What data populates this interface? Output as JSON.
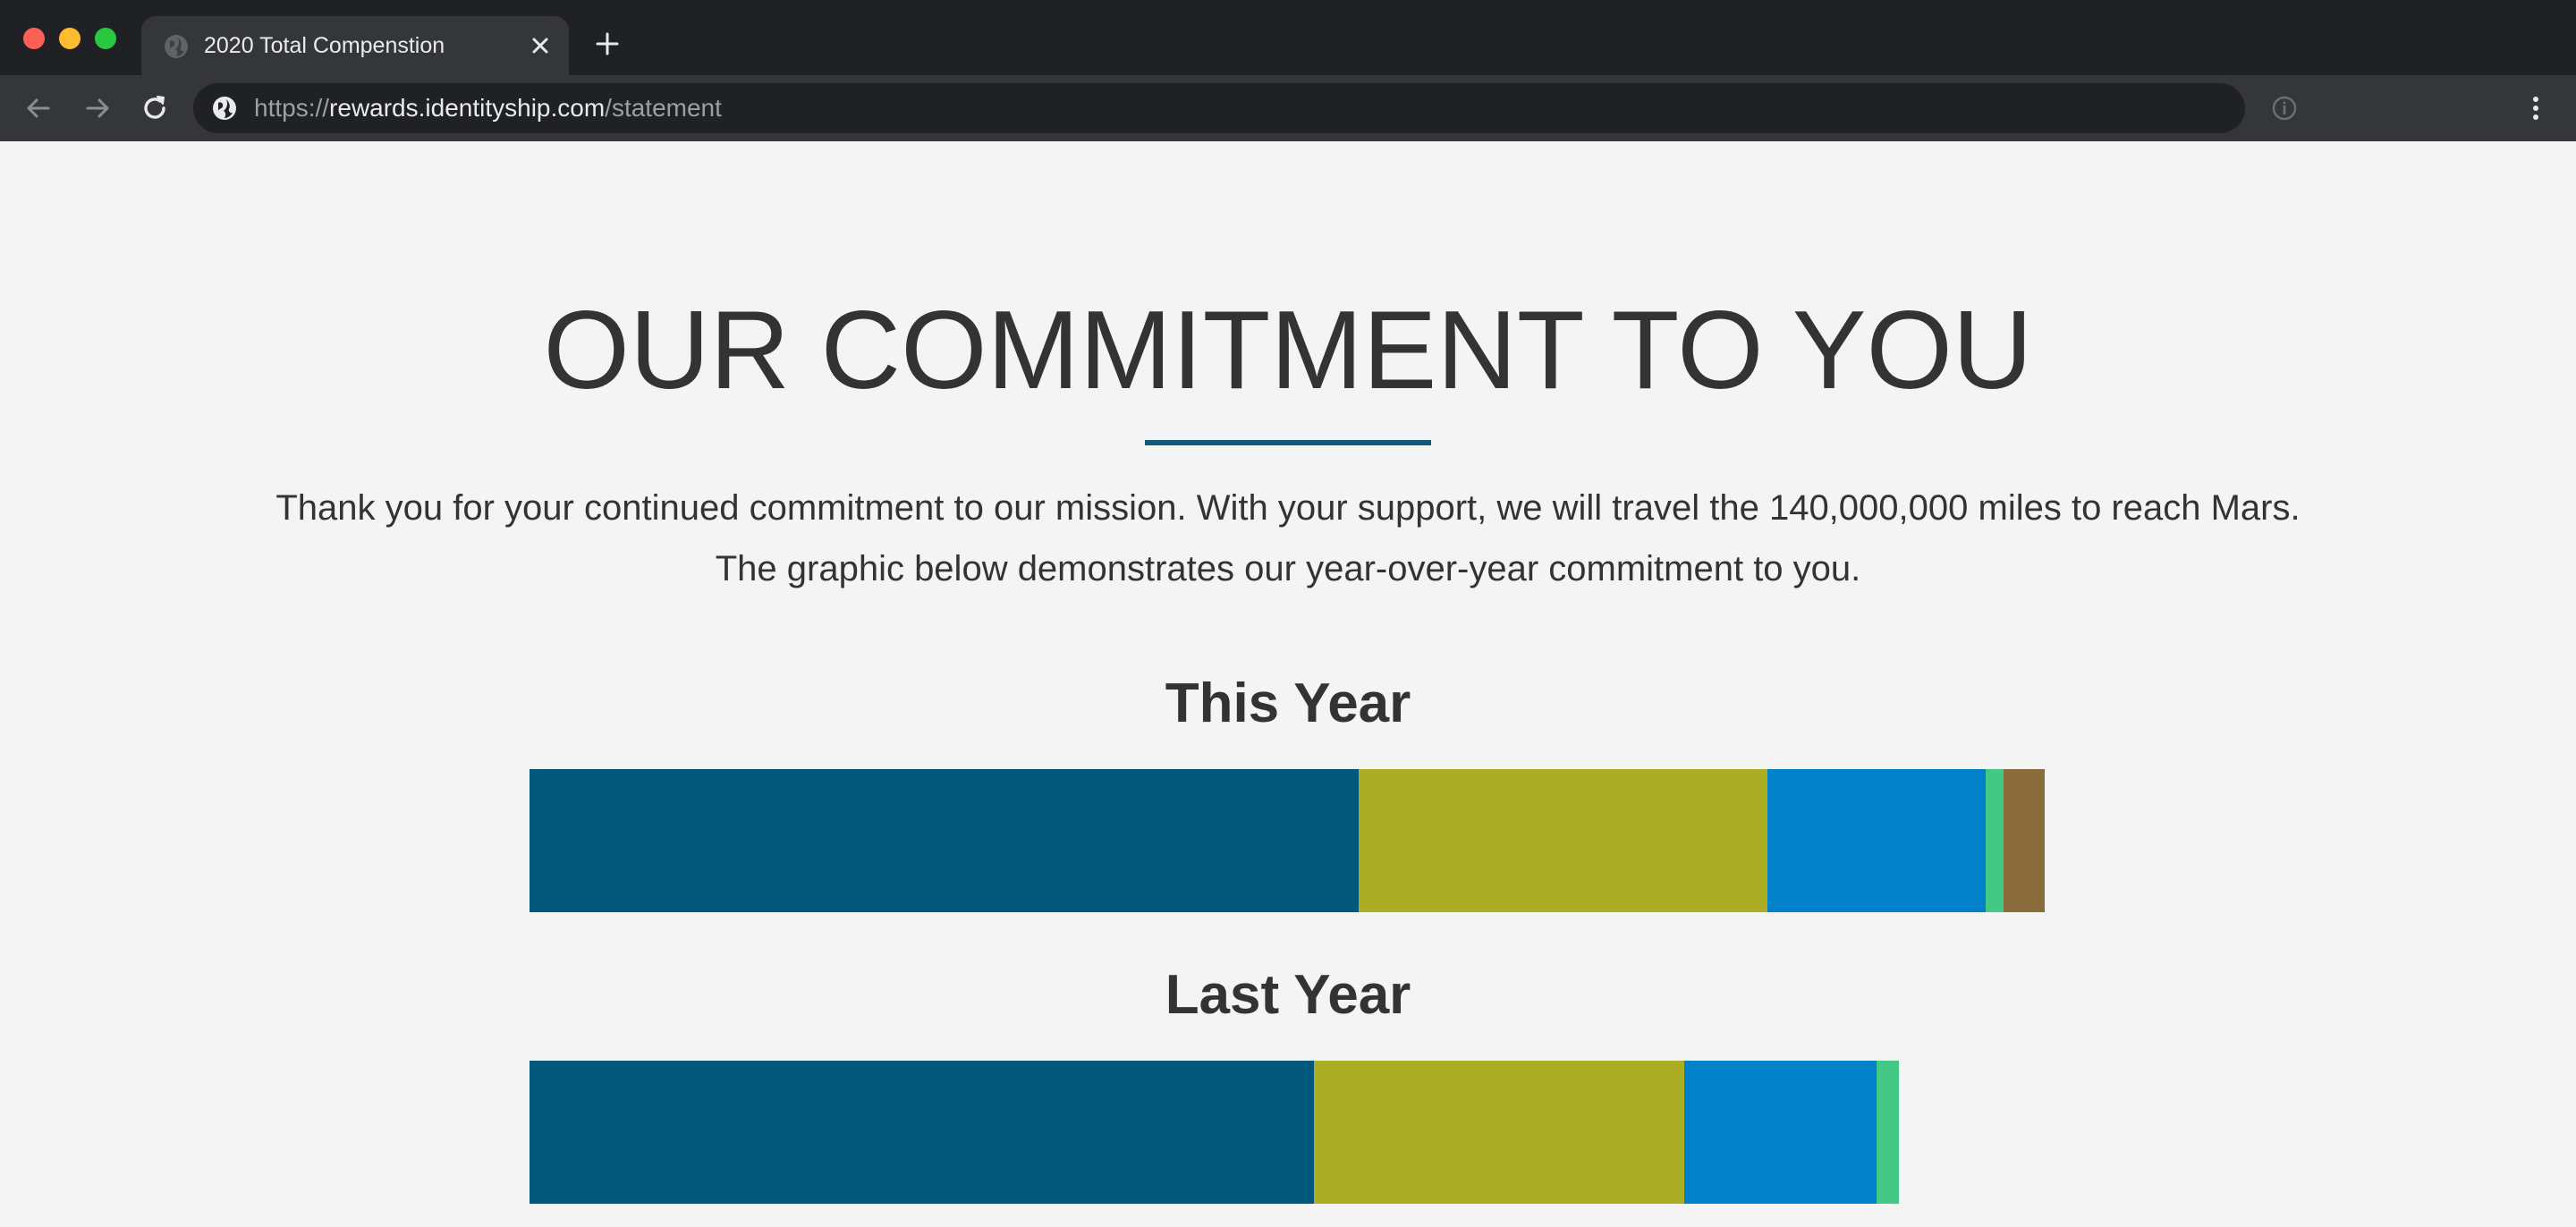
{
  "browser": {
    "tab_title": "2020 Total Compenstion",
    "url_scheme": "https://",
    "url_host": "rewards.identityship.com",
    "url_path": "/statement"
  },
  "page": {
    "headline": "OUR COMMITMENT TO YOU",
    "intro": "Thank you for your continued commitment to our mission. With your support, we will travel the 140,000,000 miles to reach Mars. The graphic below demonstrates our year-over-year commitment to you."
  },
  "colors": {
    "segment_1": "#02587a",
    "segment_2": "#abad25",
    "segment_3": "#0081c9",
    "segment_4": "#44c885",
    "segment_5": "#8b6c3d",
    "divider": "#0c5b7a"
  },
  "chart_data": {
    "type": "bar",
    "orientation": "horizontal-stacked",
    "categories": [
      "This Year",
      "Last Year"
    ],
    "scale_max": 100,
    "series": [
      {
        "color": "#02587a",
        "values": [
          54.7,
          51.8
        ]
      },
      {
        "color": "#abad25",
        "values": [
          27.0,
          24.4
        ]
      },
      {
        "color": "#0081c9",
        "values": [
          14.4,
          12.7
        ]
      },
      {
        "color": "#44c885",
        "values": [
          1.2,
          1.5
        ]
      },
      {
        "color": "#8b6c3d",
        "values": [
          2.7,
          0
        ]
      }
    ]
  }
}
